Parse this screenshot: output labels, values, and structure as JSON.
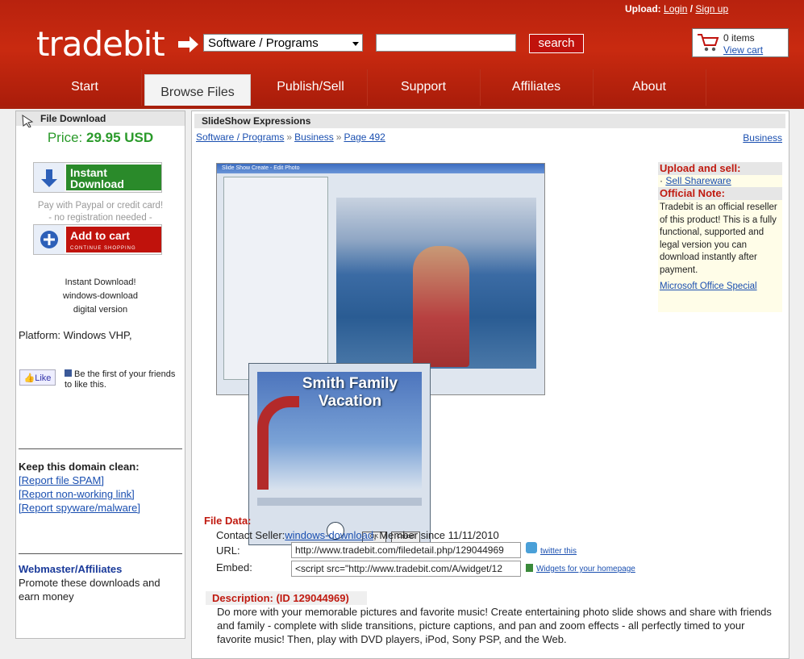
{
  "header": {
    "upload_label": "Upload:",
    "login": "Login",
    "slash": "/",
    "signup": "Sign up",
    "logo": "tradebit",
    "category_select": "Software / Programs",
    "search_button": "search",
    "cart_count": "0  items",
    "view_cart": "View cart"
  },
  "nav": {
    "tabs": [
      {
        "label": "Start"
      },
      {
        "label": "Browse Files"
      },
      {
        "label": "Publish/Sell"
      },
      {
        "label": "Support"
      },
      {
        "label": "Affiliates"
      },
      {
        "label": "About"
      }
    ]
  },
  "sidebar": {
    "header": "File Download",
    "price_label": "Price:",
    "price_value": "29.95 USD",
    "instant_label_1": "Instant",
    "instant_label_2": "Download",
    "pay_note_1": "Pay with Paypal or credit card!",
    "pay_note_2": "- no registration needed -",
    "add_to_cart": "Add to cart",
    "continue_shopping": "CONTINUE SHOPPING",
    "instant_text_1": "Instant Download!",
    "instant_text_2": "windows-download",
    "instant_text_3": "digital version",
    "platform": "Platform: Windows VHP,",
    "like": "Like",
    "fb_text": "Be the first of your friends to like this.",
    "keep_title": "Keep this domain clean:",
    "report_spam": "[Report file SPAM]",
    "report_link": "[Report non-working link]",
    "report_spyware": "[Report spyware/malware]",
    "webmaster_title": "Webmaster/Affiliates",
    "webmaster_text": "Promote these downloads and earn money"
  },
  "main": {
    "title": "SlideShow Expressions",
    "crumbs": [
      "Software / Programs",
      "Business",
      "Page 492"
    ],
    "crumb_sep": "»",
    "category_link": "Business",
    "screenshot": {
      "window_title": "Slide Show Create - Edit Photo",
      "overlay_text_1": "Smith Family",
      "overlay_text_2": "Vacation",
      "ok": "OK",
      "cancel": "Cancel"
    },
    "side": {
      "upload_title": "Upload and sell:",
      "sell_link": "Sell Shareware",
      "official_title": "Official Note:",
      "official_text": "Tradebit is an official reseller of this product! This is a fully functional, supported and legal version you can download instantly after payment.",
      "ms_link": "Microsoft Office Special"
    },
    "file_data": {
      "title": "File Data:",
      "seller_label": "Contact Seller:",
      "seller_link": "windows-download",
      "member_since": ", Member since 11/11/2010",
      "url_label": "URL:",
      "url_value": "http://www.tradebit.com/filedetail.php/129044969",
      "embed_label": "Embed:",
      "embed_value": "<script src=\"http://www.tradebit.com/A/widget/12",
      "twitter": "twitter this",
      "widgets": "Widgets for your homepage"
    },
    "description": {
      "title": "Description: (ID 129044969)",
      "text": "Do more with your memorable pictures and favorite music! Create entertaining photo slide shows and share with friends and family - complete with slide transitions, picture captions, and pan and zoom effects - all perfectly timed to your favorite music! Then, play with DVD players, iPod, Sony PSP, and the Web."
    }
  },
  "colors": {
    "header_red": "#c92a10",
    "price_green": "#2a9a2a",
    "title_red": "#c01a10",
    "link_blue": "#1a4fb0"
  }
}
